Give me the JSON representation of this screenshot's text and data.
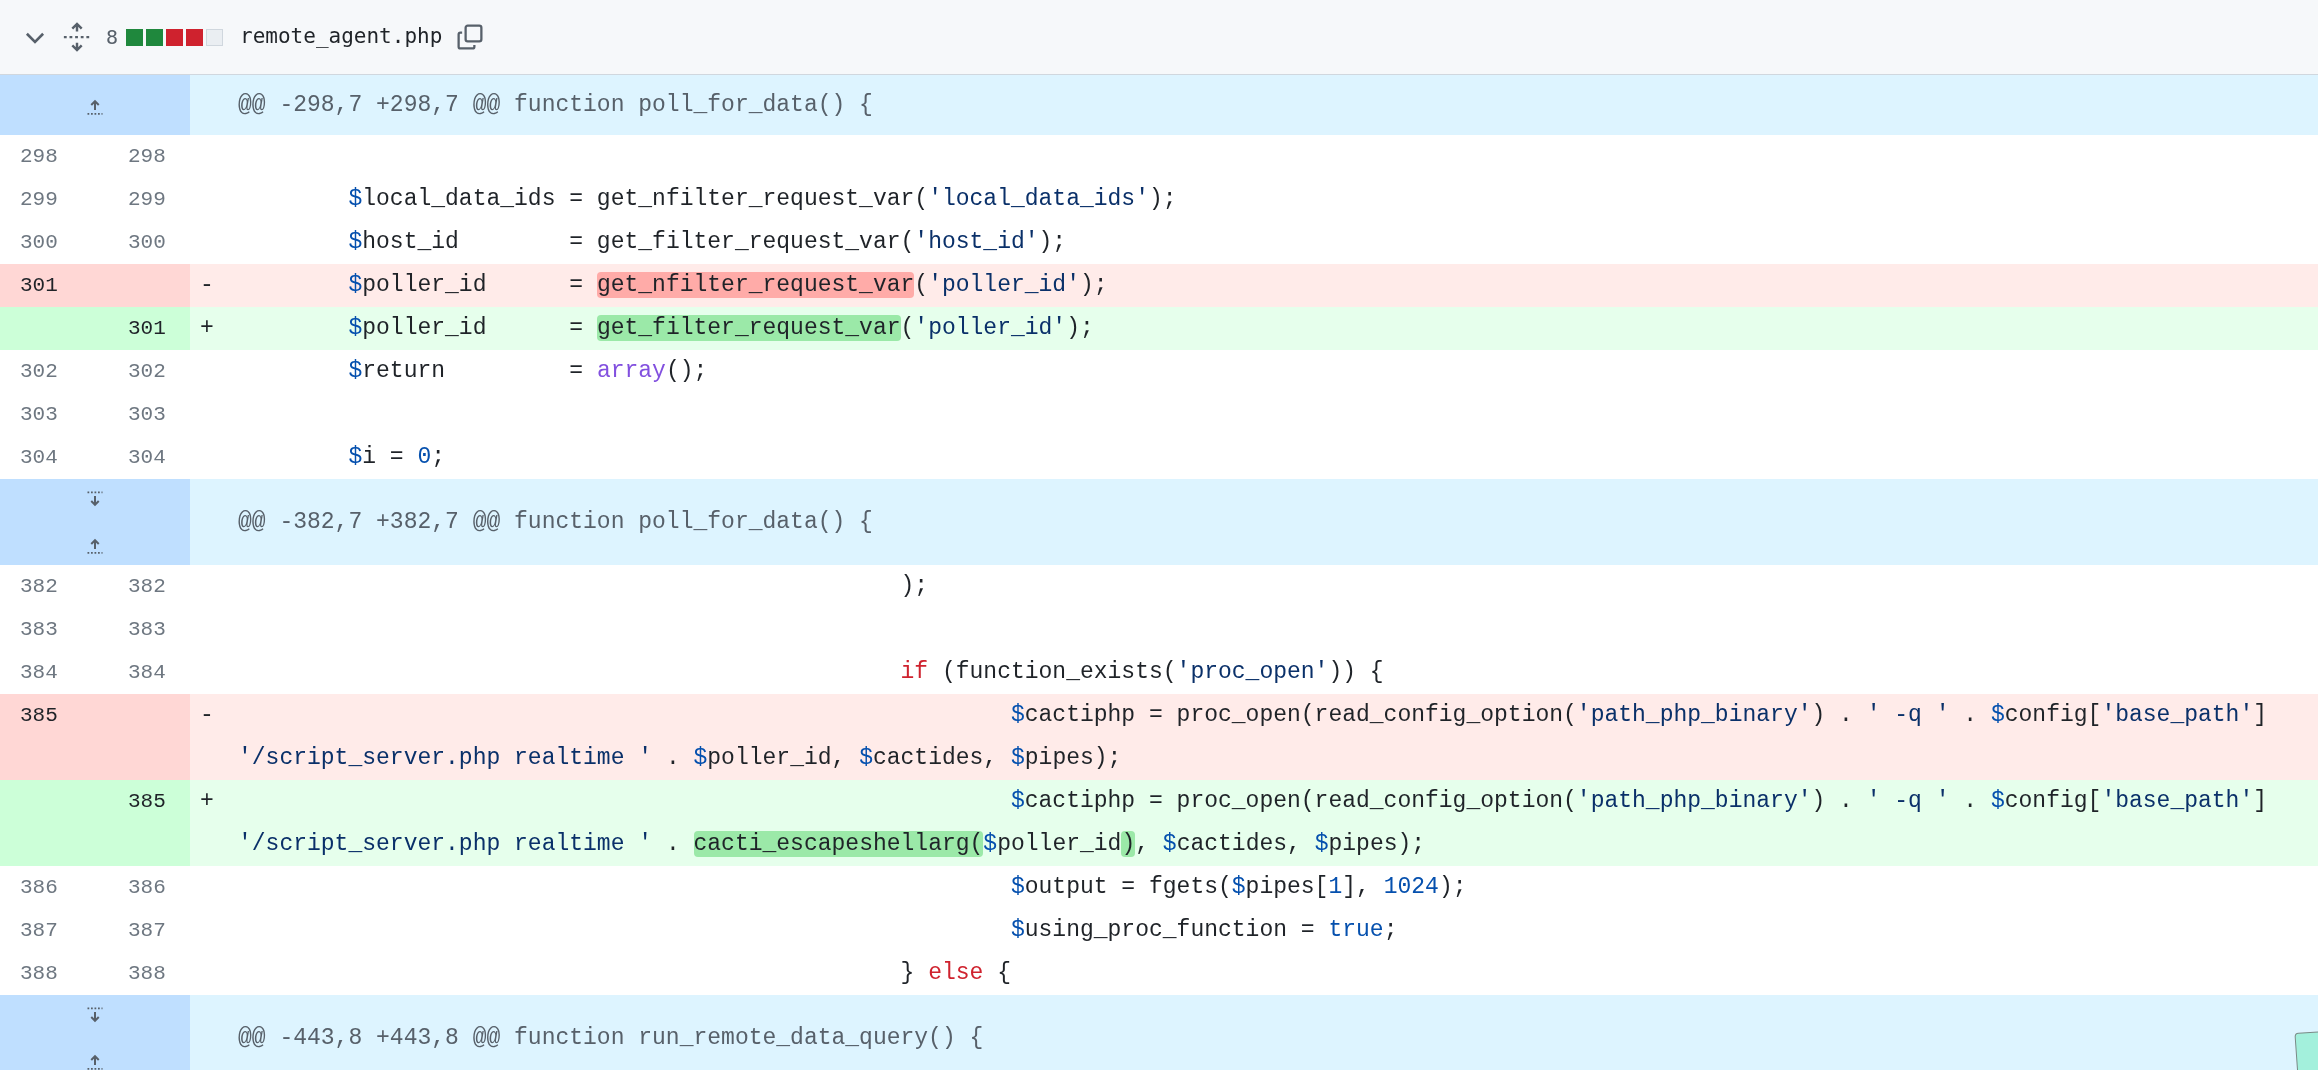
{
  "file": {
    "expanded": true,
    "changes": "8",
    "diffstat": [
      {
        "kind": "added"
      },
      {
        "kind": "added"
      },
      {
        "kind": "deleted"
      },
      {
        "kind": "deleted"
      },
      {
        "kind": "neutral"
      }
    ],
    "name": "remote_agent.php"
  },
  "hunks": [
    {
      "header": "@@ -298,7 +298,7 @@ function poll_for_data() {",
      "expand": [
        {
          "kind": "up"
        }
      ],
      "lines": [
        {
          "kind": "context",
          "old": "298",
          "new": "298"
        },
        {
          "kind": "context",
          "old": "299",
          "new": "299",
          "parts": [
            {
              "tokens": [
                {
                  "text": "\t$",
                  "kind": "var"
                },
                {
                  "text": "local_data_ids = get_nfilter_request_var("
                },
                {
                  "text": "'local_data_ids'",
                  "kind": "str"
                },
                {
                  "text": ");"
                }
              ]
            }
          ]
        },
        {
          "kind": "context",
          "old": "300",
          "new": "300",
          "parts": [
            {
              "tokens": [
                {
                  "text": "\t$",
                  "kind": "var"
                },
                {
                  "text": "host_id        = get_filter_request_var("
                },
                {
                  "text": "'host_id'",
                  "kind": "str"
                },
                {
                  "text": ");"
                }
              ]
            }
          ]
        },
        {
          "kind": "deleted",
          "old": "301",
          "sign": "-",
          "parts": [
            {
              "tokens": [
                {
                  "text": "\t$",
                  "kind": "var"
                },
                {
                  "text": "poller_id      = "
                },
                {
                  "text": "get_nfilter_request_var",
                  "changed": true
                },
                {
                  "text": "("
                },
                {
                  "text": "'poller_id'",
                  "kind": "str"
                },
                {
                  "text": ");"
                }
              ]
            }
          ]
        },
        {
          "kind": "added",
          "new": "301",
          "sign": "+",
          "parts": [
            {
              "tokens": [
                {
                  "text": "\t$",
                  "kind": "var"
                },
                {
                  "text": "poller_id      = "
                },
                {
                  "text": "get_filter_request_var",
                  "changed": true
                },
                {
                  "text": "("
                },
                {
                  "text": "'poller_id'",
                  "kind": "str"
                },
                {
                  "text": ");"
                }
              ]
            }
          ]
        },
        {
          "kind": "context",
          "old": "302",
          "new": "302",
          "parts": [
            {
              "tokens": [
                {
                  "text": "\t$",
                  "kind": "var"
                },
                {
                  "text": "return         = "
                },
                {
                  "text": "array",
                  "kind": "fn"
                },
                {
                  "text": "();"
                }
              ]
            }
          ]
        },
        {
          "kind": "context",
          "old": "303",
          "new": "303"
        },
        {
          "kind": "context",
          "old": "304",
          "new": "304",
          "parts": [
            {
              "tokens": [
                {
                  "text": "\t$",
                  "kind": "var"
                },
                {
                  "text": "i = "
                },
                {
                  "text": "0",
                  "kind": "num"
                },
                {
                  "text": ";"
                }
              ]
            }
          ]
        }
      ]
    },
    {
      "header": "@@ -382,7 +382,7 @@ function poll_for_data() {",
      "expand": [
        {
          "kind": "down"
        },
        {
          "kind": "up"
        }
      ],
      "lines": [
        {
          "kind": "context",
          "old": "382",
          "new": "382",
          "parts": [
            {
              "tokens": [
                {
                  "text": "\t\t\t\t\t\t);"
                }
              ]
            }
          ]
        },
        {
          "kind": "context",
          "old": "383",
          "new": "383"
        },
        {
          "kind": "context",
          "old": "384",
          "new": "384",
          "parts": [
            {
              "tokens": [
                {
                  "text": "\t\t\t\t\t\tif",
                  "kind": "kw"
                },
                {
                  "text": " (function_exists("
                },
                {
                  "text": "'proc_open'",
                  "kind": "str"
                },
                {
                  "text": ")) {"
                }
              ]
            }
          ]
        },
        {
          "kind": "deleted",
          "old": "385",
          "sign": "-",
          "parts": [
            {
              "tokens": [
                {
                  "text": "\t\t\t\t\t\t\t$",
                  "kind": "var"
                },
                {
                  "text": "cactiphp = proc_open(read_config_option("
                },
                {
                  "text": "'path_php_binary'",
                  "kind": "str"
                },
                {
                  "text": ") . "
                },
                {
                  "text": "' -q '",
                  "kind": "str"
                },
                {
                  "text": " . "
                },
                {
                  "text": "$",
                  "kind": "var"
                },
                {
                  "text": "config["
                },
                {
                  "text": "'base_path'",
                  "kind": "str"
                },
                {
                  "text": "]"
                }
              ]
            },
            {
              "tokens": [
                {
                  "text": "'/script_server.php realtime '",
                  "kind": "str"
                },
                {
                  "text": " . "
                },
                {
                  "text": "$",
                  "kind": "var"
                },
                {
                  "text": "poller_id, "
                },
                {
                  "text": "$",
                  "kind": "var"
                },
                {
                  "text": "cactides, "
                },
                {
                  "text": "$",
                  "kind": "var"
                },
                {
                  "text": "pipes);"
                }
              ]
            }
          ]
        },
        {
          "kind": "added",
          "new": "385",
          "sign": "+",
          "parts": [
            {
              "tokens": [
                {
                  "text": "\t\t\t\t\t\t\t$",
                  "kind": "var"
                },
                {
                  "text": "cactiphp = proc_open(read_config_option("
                },
                {
                  "text": "'path_php_binary'",
                  "kind": "str"
                },
                {
                  "text": ") . "
                },
                {
                  "text": "' -q '",
                  "kind": "str"
                },
                {
                  "text": " . "
                },
                {
                  "text": "$",
                  "kind": "var"
                },
                {
                  "text": "config["
                },
                {
                  "text": "'base_path'",
                  "kind": "str"
                },
                {
                  "text": "]"
                }
              ]
            },
            {
              "tokens": [
                {
                  "text": "'/script_server.php realtime '",
                  "kind": "str"
                },
                {
                  "text": " . "
                },
                {
                  "text": "cacti_escapeshellarg(",
                  "changed": true
                },
                {
                  "text": "$",
                  "kind": "var"
                },
                {
                  "text": "poller_id"
                },
                {
                  "text": ")",
                  "changed": true
                },
                {
                  "text": ", "
                },
                {
                  "text": "$",
                  "kind": "var"
                },
                {
                  "text": "cactides, "
                },
                {
                  "text": "$",
                  "kind": "var"
                },
                {
                  "text": "pipes);"
                }
              ]
            }
          ]
        },
        {
          "kind": "context",
          "old": "386",
          "new": "386",
          "parts": [
            {
              "tokens": [
                {
                  "text": "\t\t\t\t\t\t\t$",
                  "kind": "var"
                },
                {
                  "text": "output = fgets("
                },
                {
                  "text": "$",
                  "kind": "var"
                },
                {
                  "text": "pipes["
                },
                {
                  "text": "1",
                  "kind": "num"
                },
                {
                  "text": "], "
                },
                {
                  "text": "1024",
                  "kind": "num"
                },
                {
                  "text": ");"
                }
              ]
            }
          ]
        },
        {
          "kind": "context",
          "old": "387",
          "new": "387",
          "parts": [
            {
              "tokens": [
                {
                  "text": "\t\t\t\t\t\t\t$",
                  "kind": "var"
                },
                {
                  "text": "using_proc_function = "
                },
                {
                  "text": "true",
                  "kind": "num"
                },
                {
                  "text": ";"
                }
              ]
            }
          ]
        },
        {
          "kind": "context",
          "old": "388",
          "new": "388",
          "parts": [
            {
              "tokens": [
                {
                  "text": "\t\t\t\t\t\t} "
                },
                {
                  "text": "else",
                  "kind": "kw"
                },
                {
                  "text": " {"
                }
              ]
            }
          ]
        }
      ]
    },
    {
      "header": "@@ -443,8 +443,8 @@ function run_remote_data_query() {",
      "expand": [
        {
          "kind": "down"
        },
        {
          "kind": "up"
        }
      ]
    }
  ]
}
